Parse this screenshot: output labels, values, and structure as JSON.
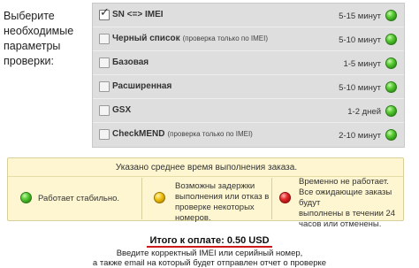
{
  "form": {
    "label": "Выберите необходимые параметры проверки:"
  },
  "options": [
    {
      "name": "SN <=> IMEI",
      "note": "",
      "time": "5-15 минут",
      "checked": true,
      "status": "green"
    },
    {
      "name": "Черный список",
      "note": "(проверка только по IMEI)",
      "time": "5-10 минут",
      "checked": false,
      "status": "green"
    },
    {
      "name": "Базовая",
      "note": "",
      "time": "1-5 минут",
      "checked": false,
      "status": "green"
    },
    {
      "name": "Расширенная",
      "note": "",
      "time": "5-10 минут",
      "checked": false,
      "status": "green"
    },
    {
      "name": "GSX",
      "note": "",
      "time": "1-2 дней",
      "checked": false,
      "status": "green"
    },
    {
      "name": "CheckMEND",
      "note": "(проверка только по IMEI)",
      "time": "2-10 минут",
      "checked": false,
      "status": "green"
    }
  ],
  "legend": {
    "heading": "Указано среднее время выполнения заказа.",
    "items": [
      {
        "status": "green",
        "text": "Работает стабильно."
      },
      {
        "status": "yellow",
        "lines": [
          "Возможны задержки",
          "выполнения или отказ в",
          "проверке некоторых номеров."
        ]
      },
      {
        "status": "red",
        "lines": [
          "Временно не работает.",
          "Все ожидающие заказы будут",
          "выполнены в течении 24",
          "часов или отменены."
        ]
      }
    ]
  },
  "summary": {
    "total": "Итого к оплате: 0.50 USD",
    "hint_1": "Введите корректный IMEI или серийный номер,",
    "hint_2": "а также email на который будет отправлен отчет о проверке"
  },
  "colors": {
    "ok": "#3fbf1f",
    "warn": "#f2c514",
    "down": "#e62a2a",
    "total_underline": "#cc1a1a",
    "legend_bg": "#fdf6d0"
  }
}
